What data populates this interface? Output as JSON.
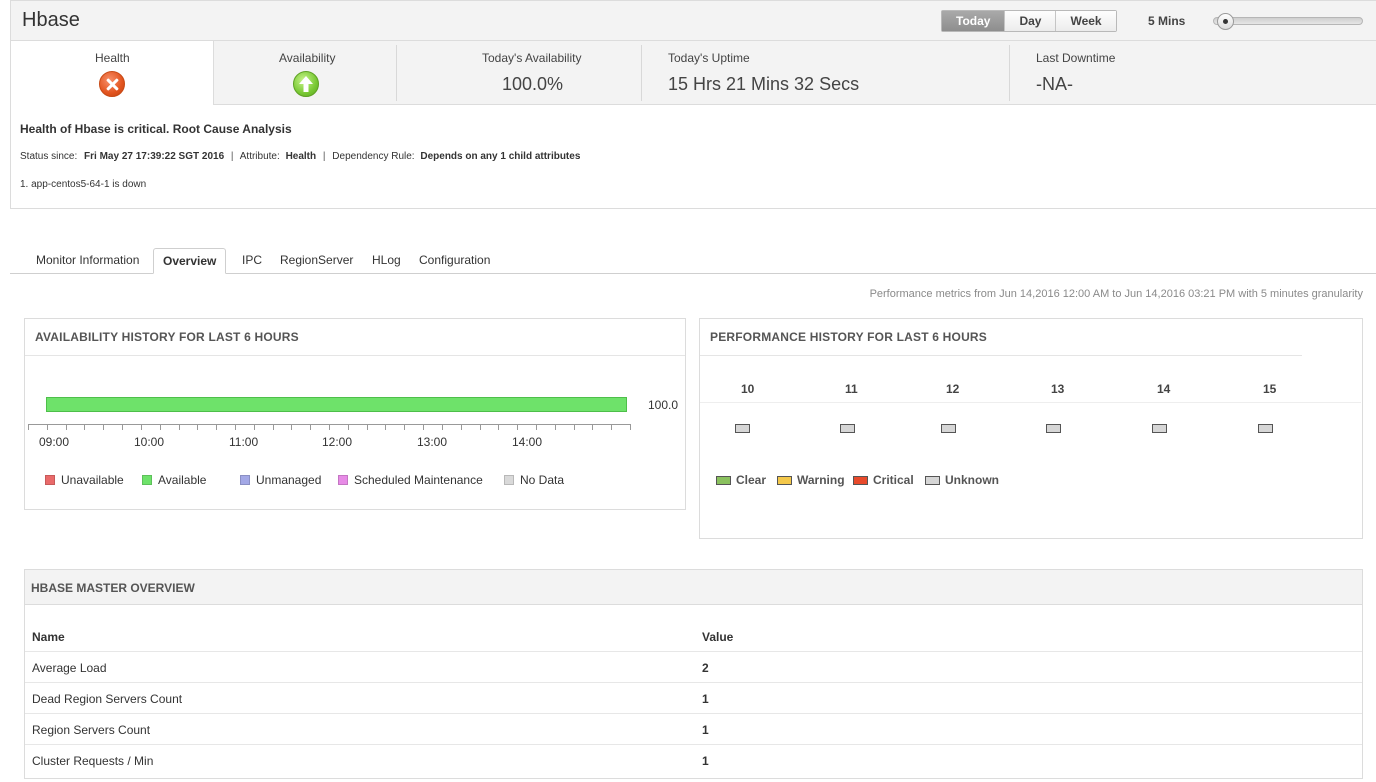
{
  "header": {
    "title": "Hbase",
    "ranges": [
      "Today",
      "Day",
      "Week"
    ],
    "active_range": "Today",
    "interval": "5 Mins",
    "interval_slider_fraction": 0.05
  },
  "summary": {
    "health_label": "Health",
    "health_icon": "critical-icon",
    "availability_label": "Availability",
    "availability_icon": "up-arrow-icon",
    "todays_availability_label": "Today's Availability",
    "todays_availability_value": "100.0%",
    "todays_uptime_label": "Today's Uptime",
    "todays_uptime_value": "15 Hrs 21 Mins 32 Secs",
    "last_downtime_label": "Last Downtime",
    "last_downtime_value": "-NA-"
  },
  "rca": {
    "title": "Health of Hbase is critical. Root Cause Analysis",
    "status_since_label": "Status since:",
    "status_since_value": "Fri May 27 17:39:22 SGT 2016",
    "attribute_label": "Attribute:",
    "attribute_value": "Health",
    "dependency_label": "Dependency Rule:",
    "dependency_value": "Depends on any 1 child attributes",
    "items": [
      "1. app-centos5-64-1 is down"
    ]
  },
  "tabs": [
    "Monitor Information",
    "Overview",
    "IPC",
    "RegionServer",
    "HLog",
    "Configuration"
  ],
  "active_tab": "Overview",
  "perf_note": "Performance metrics from Jun 14,2016 12:00 AM to Jun 14,2016 03:21 PM with 5 minutes granularity",
  "availability_panel": {
    "title": "AVAILABILITY HISTORY FOR LAST 6 HOURS",
    "bar_value": "100.0",
    "time_labels": [
      "09:00",
      "10:00",
      "11:00",
      "12:00",
      "13:00",
      "14:00"
    ],
    "legend": [
      {
        "label": "Unavailable",
        "color": "#e96a6a"
      },
      {
        "label": "Available",
        "color": "#6ee26a"
      },
      {
        "label": "Unmanaged",
        "color": "#a3a8e6"
      },
      {
        "label": "Scheduled Maintenance",
        "color": "#e78be6"
      },
      {
        "label": "No Data",
        "color": "#d9d9d9"
      }
    ]
  },
  "performance_panel": {
    "title": "PERFORMANCE HISTORY FOR LAST 6 HOURS",
    "hours": [
      "10",
      "11",
      "12",
      "13",
      "14",
      "15"
    ],
    "legend": [
      {
        "label": "Clear",
        "color": "#8ac15e"
      },
      {
        "label": "Warning",
        "color": "#f4c84a"
      },
      {
        "label": "Critical",
        "color": "#e84a2b"
      },
      {
        "label": "Unknown",
        "color": "#d6d6d6"
      }
    ]
  },
  "master_overview": {
    "title": "HBASE MASTER OVERVIEW",
    "columns": [
      "Name",
      "Value"
    ],
    "rows": [
      {
        "name": "Average Load",
        "value": "2"
      },
      {
        "name": "Dead Region Servers Count",
        "value": "1"
      },
      {
        "name": "Region Servers Count",
        "value": "1"
      },
      {
        "name": "Cluster Requests / Min",
        "value": "1"
      }
    ]
  }
}
